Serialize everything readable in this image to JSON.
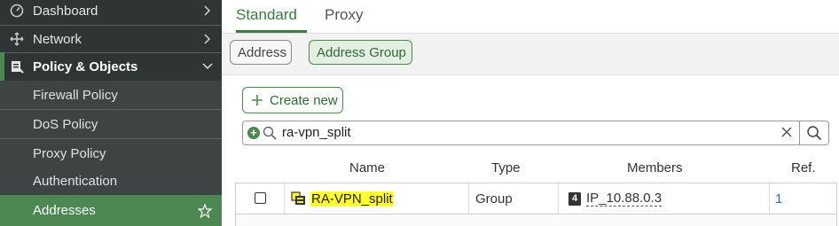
{
  "sidebar": {
    "items": [
      {
        "label": "Dashboard",
        "icon": "dashboard-icon"
      },
      {
        "label": "Network",
        "icon": "network-icon"
      },
      {
        "label": "Policy & Objects",
        "icon": "policy-icon"
      },
      {
        "label": "Firewall Policy"
      },
      {
        "label": "DoS Policy"
      },
      {
        "label": "Proxy Policy"
      },
      {
        "label": "Authentication"
      },
      {
        "label": "Addresses"
      }
    ],
    "accent": "#4d8751"
  },
  "tabs": [
    {
      "label": "Standard",
      "active": true
    },
    {
      "label": "Proxy",
      "active": false
    }
  ],
  "subtabs": [
    {
      "label": "Address",
      "active": false
    },
    {
      "label": "Address Group",
      "active": true
    }
  ],
  "toolbar": {
    "create_label": "Create new"
  },
  "search": {
    "value": "ra-vpn_split"
  },
  "table": {
    "columns": [
      "Name",
      "Type",
      "Members",
      "Ref."
    ],
    "rows": [
      {
        "name": "RA-VPN_split",
        "type": "Group",
        "members": "IP_10.88.0.3",
        "member_badge": "4",
        "ref": "1"
      }
    ]
  }
}
